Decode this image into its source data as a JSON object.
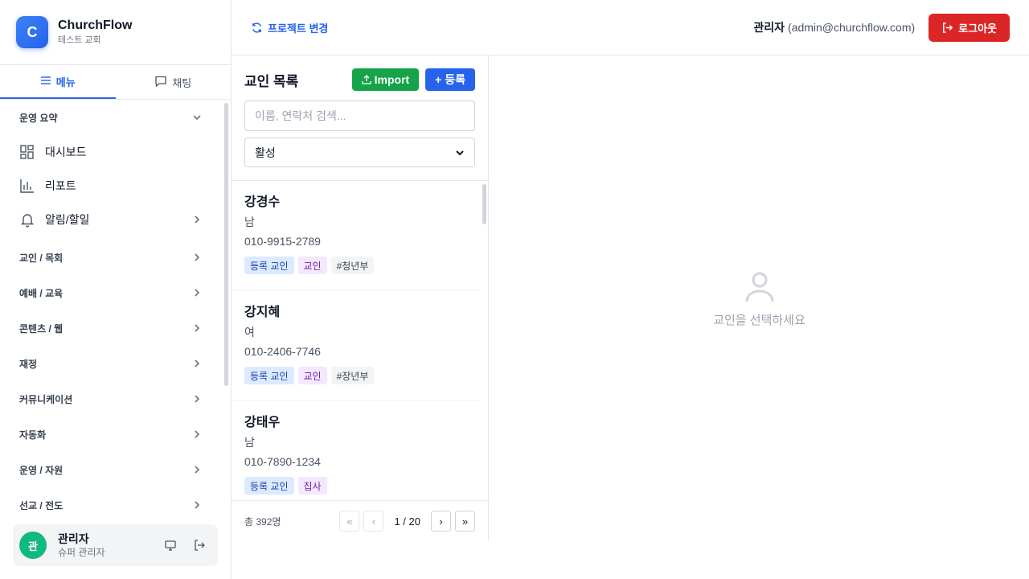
{
  "brand": {
    "logo_letter": "C",
    "name": "ChurchFlow",
    "subtitle": "테스트 교회"
  },
  "side_tabs": [
    {
      "label": "메뉴",
      "icon": "menu-icon",
      "active": true
    },
    {
      "label": "채팅",
      "icon": "chat-icon",
      "active": false
    }
  ],
  "menu": {
    "section_summary": "운영 요약",
    "dashboard": "대시보드",
    "report": "리포트",
    "alerts": "알림/할일",
    "sections": [
      "교인 / 목회",
      "예배 / 교육",
      "콘텐츠 / 웹",
      "재정",
      "커뮤니케이션",
      "자동화",
      "운영 / 자원",
      "선교 / 전도"
    ]
  },
  "user": {
    "avatar": "관",
    "name": "관리자",
    "role": "슈퍼 관리자"
  },
  "topbar": {
    "project_change": "프로젝트 변경",
    "admin_label": "관리자",
    "admin_email": "(admin@churchflow.com)",
    "logout": "로그아웃"
  },
  "list": {
    "title": "교인 목록",
    "import_label": "Import",
    "add_label": "+ 등록",
    "search_placeholder": "이름, 연락처 검색...",
    "status_filter": "활성",
    "members": [
      {
        "name": "강경수",
        "gender": "남",
        "phone": "010-9915-2789",
        "tags": [
          "등록 교인",
          "교인",
          "#청년부"
        ]
      },
      {
        "name": "강지혜",
        "gender": "여",
        "phone": "010-2406-7746",
        "tags": [
          "등록 교인",
          "교인",
          "#장년부"
        ]
      },
      {
        "name": "강태우",
        "gender": "남",
        "phone": "010-7890-1234",
        "tags": [
          "등록 교인",
          "집사"
        ]
      }
    ],
    "total": "총 392명",
    "page": "1 / 20",
    "pager": {
      "first": "«",
      "prev": "‹",
      "next": "›",
      "last": "»"
    }
  },
  "detail": {
    "empty_text": "교인을 선택하세요"
  },
  "colors": {
    "primary": "#2563eb",
    "success": "#16a34a",
    "danger": "#dc2626",
    "avatar": "#10b981"
  }
}
